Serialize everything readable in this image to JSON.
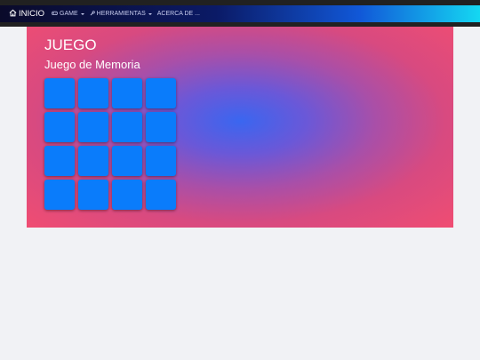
{
  "navbar": {
    "brand_label": "INICIO",
    "game_label": "GAME",
    "tools_label": "HERRAMIENTAS",
    "about_label": "ACERCA DE ..."
  },
  "main": {
    "title": "JUEGO",
    "subtitle": "Juego de Memoria"
  },
  "board": {
    "rows": 4,
    "columns": 4,
    "card_count": 16
  },
  "colors": {
    "card": "#0a7cfb",
    "nav_start": "#0a0a2a",
    "nav_end": "#14d8f2",
    "panel_center": "#3a66f0",
    "panel_edge": "#f04d72",
    "page_background": "#f1f2f5"
  },
  "icons": {
    "brand": "house-icon",
    "game": "gamepad-icon",
    "tools": "wrench-icon"
  }
}
